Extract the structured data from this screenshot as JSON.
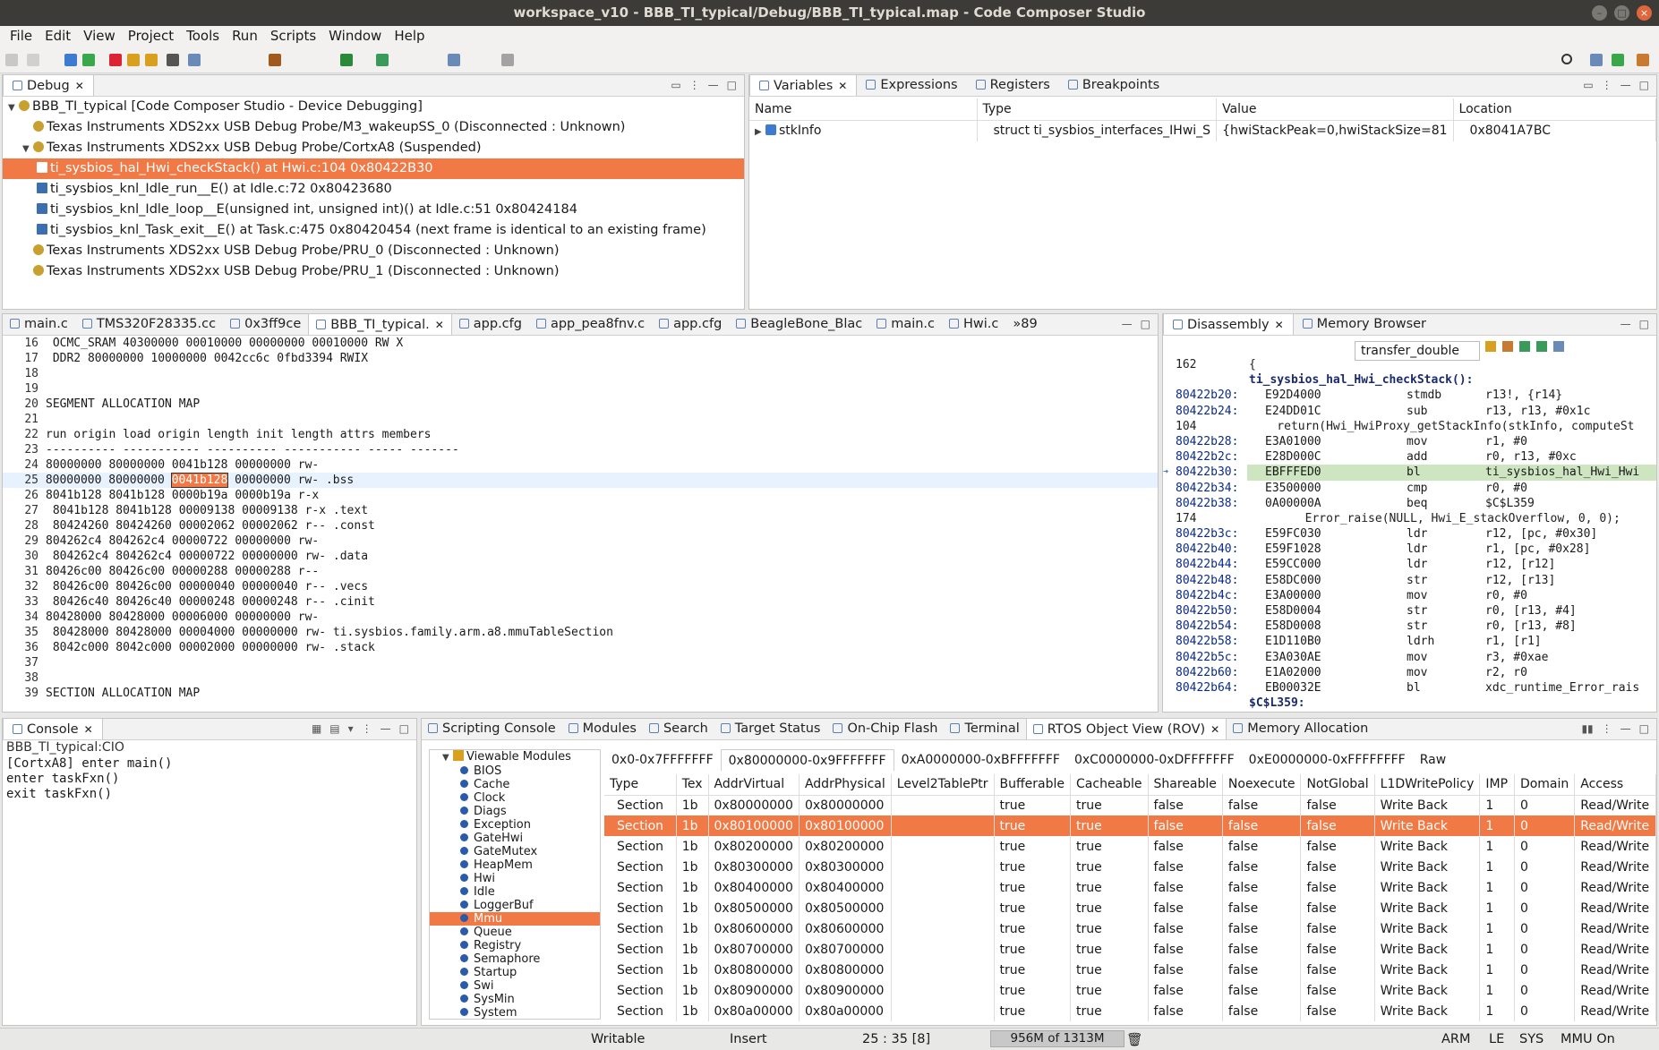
{
  "window": {
    "title": "workspace_v10 - BBB_TI_typical/Debug/BBB_TI_typical.map - Code Composer Studio"
  },
  "menu": [
    "File",
    "Edit",
    "View",
    "Project",
    "Tools",
    "Run",
    "Scripts",
    "Window",
    "Help"
  ],
  "debug": {
    "tab": "Debug",
    "rows": [
      {
        "text": "BBB_TI_typical [Code Composer Studio - Device Debugging]",
        "indent": 0
      },
      {
        "text": "Texas Instruments XDS2xx USB Debug Probe/M3_wakeupSS_0 (Disconnected : Unknown)",
        "indent": 1
      },
      {
        "text": "Texas Instruments XDS2xx USB Debug Probe/CortxA8 (Suspended)",
        "indent": 1
      },
      {
        "text": "ti_sysbios_hal_Hwi_checkStack() at Hwi.c:104 0x80422B30",
        "indent": 2
      },
      {
        "text": "ti_sysbios_knl_Idle_run__E() at Idle.c:72 0x80423680",
        "indent": 2
      },
      {
        "text": "ti_sysbios_knl_Idle_loop__E(unsigned int, unsigned int)() at Idle.c:51 0x80424184",
        "indent": 2
      },
      {
        "text": "ti_sysbios_knl_Task_exit__E() at Task.c:475 0x80420454  (next frame is identical to an existing frame)",
        "indent": 2
      },
      {
        "text": "Texas Instruments XDS2xx USB Debug Probe/PRU_0 (Disconnected : Unknown)",
        "indent": 1
      },
      {
        "text": "Texas Instruments XDS2xx USB Debug Probe/PRU_1 (Disconnected : Unknown)",
        "indent": 1
      }
    ]
  },
  "vars": {
    "tabs": [
      "Variables",
      "Expressions",
      "Registers",
      "Breakpoints"
    ],
    "headers": [
      "Name",
      "Type",
      "Value",
      "Location"
    ],
    "row": {
      "name": "stkInfo",
      "type": "struct ti_sysbios_interfaces_IHwi_S",
      "value": "{hwiStackPeak=0,hwiStackSize=81",
      "location": "0x8041A7BC"
    }
  },
  "editor": {
    "tabs": [
      "main.c",
      "TMS320F28335.cc",
      "0x3ff9ce",
      "BBB_TI_typical.",
      "app.cfg",
      "app_pea8fnv.c",
      "app.cfg",
      "BeagleBone_Blac",
      "main.c",
      "Hwi.c",
      "»89"
    ],
    "lines": [
      {
        "n": "16",
        "t": "  OCMC_SRAM             40300000   00010000  00000000  00010000  RW X"
      },
      {
        "n": "17",
        "t": "  DDR2                  80000000   10000000  0042cc6c  0fbd3394  RWIX"
      },
      {
        "n": "18",
        "t": ""
      },
      {
        "n": "19",
        "t": ""
      },
      {
        "n": "20",
        "t": "SEGMENT ALLOCATION MAP"
      },
      {
        "n": "21",
        "t": ""
      },
      {
        "n": "22",
        "t": "run origin  load origin   length   init length attrs members"
      },
      {
        "n": "23",
        "t": "----------  ----------- ---------- ----------- ----- -------"
      },
      {
        "n": "24",
        "t": "80000000    80000000    0041b128   00000000    rw-"
      },
      {
        "n": "25",
        "t": "  80000000    80000000    |0041b128|   00000000    rw- .bss"
      },
      {
        "n": "26",
        "t": "8041b128    8041b128    0000b19a   0000b19a    r-x"
      },
      {
        "n": "27",
        "t": "  8041b128    8041b128    00009138   00009138    r-x .text"
      },
      {
        "n": "28",
        "t": "  80424260    80424260    00002062   00002062    r-- .const"
      },
      {
        "n": "29",
        "t": "804262c4    804262c4    00000722   00000000    rw-"
      },
      {
        "n": "30",
        "t": "  804262c4    804262c4    00000722   00000000    rw- .data"
      },
      {
        "n": "31",
        "t": "80426c00    80426c00    00000288   00000288    r--"
      },
      {
        "n": "32",
        "t": "  80426c00    80426c00    00000040   00000040    r-- .vecs"
      },
      {
        "n": "33",
        "t": "  80426c40    80426c40    00000248   00000248    r-- .cinit"
      },
      {
        "n": "34",
        "t": "80428000    80428000    00006000   00000000    rw-"
      },
      {
        "n": "35",
        "t": "  80428000    80428000    00004000   00000000    rw- ti.sysbios.family.arm.a8.mmuTableSection"
      },
      {
        "n": "36",
        "t": "  8042c000    8042c000    00002000   00000000    rw- .stack"
      },
      {
        "n": "37",
        "t": ""
      },
      {
        "n": "38",
        "t": ""
      },
      {
        "n": "39",
        "t": "SECTION ALLOCATION MAP"
      }
    ]
  },
  "disasm": {
    "tabs": [
      "Disassembly",
      "Memory Browser"
    ],
    "search": "transfer_double",
    "lines": [
      {
        "a": "162",
        "o": "",
        "m": "",
        "r": "{"
      },
      {
        "a": "",
        "o": "",
        "m": "",
        "r": "ti_sysbios_hal_Hwi_checkStack():",
        "b": true
      },
      {
        "a": "80422b20:",
        "o": "E92D4000",
        "m": "stmdb",
        "r": "r13!, {r14}"
      },
      {
        "a": "80422b24:",
        "o": "E24DD01C",
        "m": "sub",
        "r": "r13, r13, #0x1c"
      },
      {
        "a": "104",
        "o": "",
        "m": "",
        "r": "    return(Hwi_HwiProxy_getStackInfo(stkInfo, computeSt"
      },
      {
        "a": "80422b28:",
        "o": "E3A01000",
        "m": "mov",
        "r": "r1, #0"
      },
      {
        "a": "80422b2c:",
        "o": "E28D000C",
        "m": "add",
        "r": "r0, r13, #0xc"
      },
      {
        "a": "80422b30:",
        "o": "EBFFFED0",
        "m": "bl",
        "r": "ti_sysbios_hal_Hwi_Hwi",
        "cur": true
      },
      {
        "a": "80422b34:",
        "o": "E3500000",
        "m": "cmp",
        "r": "r0, #0"
      },
      {
        "a": "80422b38:",
        "o": "0A00000A",
        "m": "beq",
        "r": "$C$L359"
      },
      {
        "a": "174",
        "o": "",
        "m": "",
        "r": "        Error_raise(NULL, Hwi_E_stackOverflow, 0, 0);"
      },
      {
        "a": "80422b3c:",
        "o": "E59FC030",
        "m": "ldr",
        "r": "r12, [pc, #0x30]"
      },
      {
        "a": "80422b40:",
        "o": "E59F1028",
        "m": "ldr",
        "r": "r1, [pc, #0x28]"
      },
      {
        "a": "80422b44:",
        "o": "E59CC000",
        "m": "ldr",
        "r": "r12, [r12]"
      },
      {
        "a": "80422b48:",
        "o": "E58DC000",
        "m": "str",
        "r": "r12, [r13]"
      },
      {
        "a": "80422b4c:",
        "o": "E3A00000",
        "m": "mov",
        "r": "r0, #0"
      },
      {
        "a": "80422b50:",
        "o": "E58D0004",
        "m": "str",
        "r": "r0, [r13, #4]"
      },
      {
        "a": "80422b54:",
        "o": "E58D0008",
        "m": "str",
        "r": "r0, [r13, #8]"
      },
      {
        "a": "80422b58:",
        "o": "E1D110B0",
        "m": "ldrh",
        "r": "r1, [r1]"
      },
      {
        "a": "80422b5c:",
        "o": "E3A030AE",
        "m": "mov",
        "r": "r3, #0xae"
      },
      {
        "a": "80422b60:",
        "o": "E1A02000",
        "m": "mov",
        "r": "r2, r0"
      },
      {
        "a": "80422b64:",
        "o": "EB00032E",
        "m": "bl",
        "r": "xdc_runtime_Error_rais"
      },
      {
        "a": "$C$L359:",
        "o": "",
        "m": "",
        "r": "",
        "b": true
      }
    ]
  },
  "console": {
    "tab": "Console",
    "title": "BBB_TI_typical:CIO",
    "lines": [
      "[CortxA8] enter main()",
      "enter taskFxn()",
      "exit taskFxn()"
    ]
  },
  "bottom": {
    "tabs": [
      "Scripting Console",
      "Modules",
      "Search",
      "Target Status",
      "On-Chip Flash",
      "Terminal",
      "RTOS Object View (ROV)",
      "Memory Allocation"
    ],
    "tree_root": "Viewable Modules",
    "modules": [
      "BIOS",
      "Cache",
      "Clock",
      "Diags",
      "Exception",
      "GateHwi",
      "GateMutex",
      "HeapMem",
      "Hwi",
      "Idle",
      "LoggerBuf",
      "Mmu",
      "Queue",
      "Registry",
      "Semaphore",
      "Startup",
      "Swi",
      "SysMin",
      "System"
    ],
    "ranges": [
      "0x0-0x7FFFFFFF",
      "0x80000000-0x9FFFFFFF",
      "0xA0000000-0xBFFFFFFF",
      "0xC0000000-0xDFFFFFFF",
      "0xE0000000-0xFFFFFFFF",
      "Raw"
    ],
    "headers": [
      "Type",
      "Tex",
      "AddrVirtual",
      "AddrPhysical",
      "Level2TablePtr",
      "Bufferable",
      "Cacheable",
      "Shareable",
      "Noexecute",
      "NotGlobal",
      "L1DWritePolicy",
      "IMP",
      "Domain",
      "Access"
    ],
    "rows": [
      [
        "Section",
        "1b",
        "0x80000000",
        "0x80000000",
        "",
        "true",
        "true",
        "false",
        "false",
        "false",
        "Write Back",
        "1",
        "0",
        "Read/Write"
      ],
      [
        "Section",
        "1b",
        "0x80100000",
        "0x80100000",
        "",
        "true",
        "true",
        "false",
        "false",
        "false",
        "Write Back",
        "1",
        "0",
        "Read/Write"
      ],
      [
        "Section",
        "1b",
        "0x80200000",
        "0x80200000",
        "",
        "true",
        "true",
        "false",
        "false",
        "false",
        "Write Back",
        "1",
        "0",
        "Read/Write"
      ],
      [
        "Section",
        "1b",
        "0x80300000",
        "0x80300000",
        "",
        "true",
        "true",
        "false",
        "false",
        "false",
        "Write Back",
        "1",
        "0",
        "Read/Write"
      ],
      [
        "Section",
        "1b",
        "0x80400000",
        "0x80400000",
        "",
        "true",
        "true",
        "false",
        "false",
        "false",
        "Write Back",
        "1",
        "0",
        "Read/Write"
      ],
      [
        "Section",
        "1b",
        "0x80500000",
        "0x80500000",
        "",
        "true",
        "true",
        "false",
        "false",
        "false",
        "Write Back",
        "1",
        "0",
        "Read/Write"
      ],
      [
        "Section",
        "1b",
        "0x80600000",
        "0x80600000",
        "",
        "true",
        "true",
        "false",
        "false",
        "false",
        "Write Back",
        "1",
        "0",
        "Read/Write"
      ],
      [
        "Section",
        "1b",
        "0x80700000",
        "0x80700000",
        "",
        "true",
        "true",
        "false",
        "false",
        "false",
        "Write Back",
        "1",
        "0",
        "Read/Write"
      ],
      [
        "Section",
        "1b",
        "0x80800000",
        "0x80800000",
        "",
        "true",
        "true",
        "false",
        "false",
        "false",
        "Write Back",
        "1",
        "0",
        "Read/Write"
      ],
      [
        "Section",
        "1b",
        "0x80900000",
        "0x80900000",
        "",
        "true",
        "true",
        "false",
        "false",
        "false",
        "Write Back",
        "1",
        "0",
        "Read/Write"
      ],
      [
        "Section",
        "1b",
        "0x80a00000",
        "0x80a00000",
        "",
        "true",
        "true",
        "false",
        "false",
        "false",
        "Write Back",
        "1",
        "0",
        "Read/Write"
      ]
    ]
  },
  "status": {
    "mode": "Writable",
    "insert": "Insert",
    "pos": "25 : 35 [8]",
    "heap": "956M of 1313M",
    "flags": [
      "ARM",
      "LE",
      "SYS",
      "MMU On"
    ]
  },
  "colors": {
    "select": "#f07946",
    "disasm_cur": "#cde5c0"
  }
}
